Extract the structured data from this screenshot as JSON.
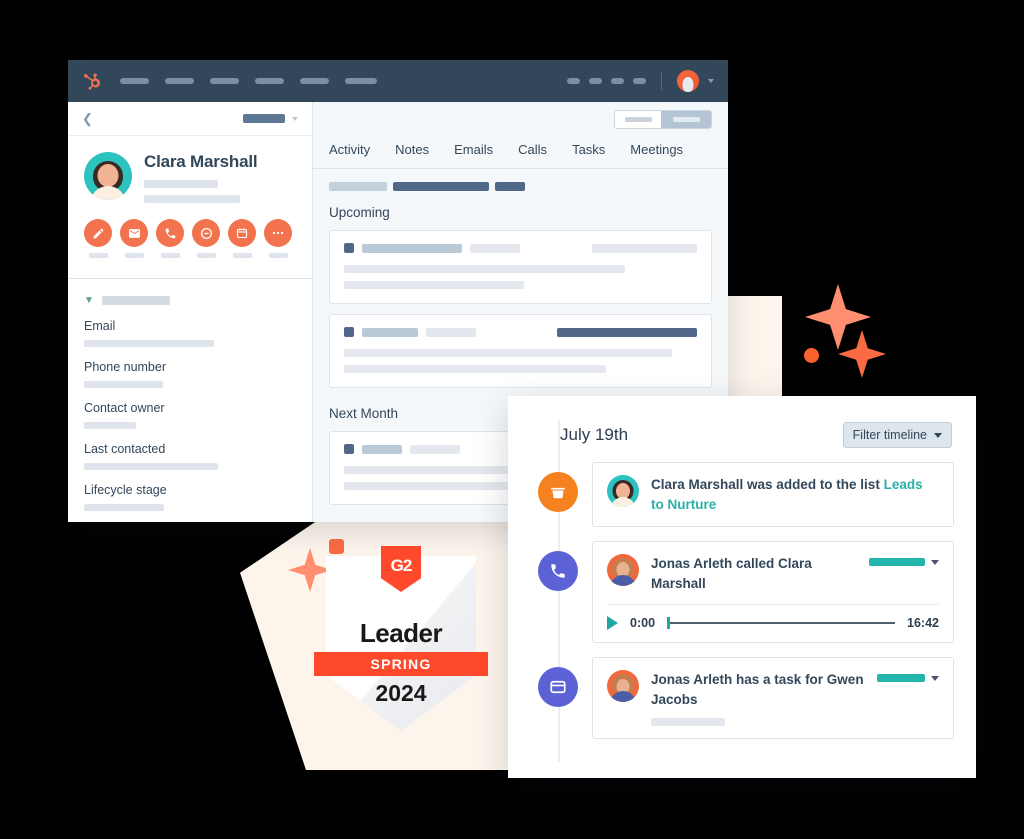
{
  "crm": {
    "navbar": {
      "logo_icon": "hubspot-sprocket-logo",
      "avatar_icon": "user-avatar",
      "caret_icon": "chevron-down-icon"
    },
    "sidebar": {
      "back_icon": "chevron-left-icon",
      "contact_name": "Clara Marshall",
      "actions": [
        {
          "icon": "note-pencil-icon",
          "name": "note"
        },
        {
          "icon": "email-envelope-icon",
          "name": "email"
        },
        {
          "icon": "phone-call-icon",
          "name": "call"
        },
        {
          "icon": "log-activity-icon",
          "name": "log"
        },
        {
          "icon": "calendar-meeting-icon",
          "name": "meeting"
        },
        {
          "icon": "ellipsis-more-icon",
          "name": "more"
        }
      ],
      "section_chevron_icon": "chevron-down-icon",
      "properties": [
        {
          "label": "Email",
          "value_width": 130
        },
        {
          "label": "Phone number",
          "value_width": 79
        },
        {
          "label": "Contact owner",
          "value_width": 52
        },
        {
          "label": "Last contacted",
          "value_width": 134
        },
        {
          "label": "Lifecycle stage",
          "value_width": 80
        }
      ]
    },
    "content": {
      "tabs": [
        "Activity",
        "Notes",
        "Emails",
        "Calls",
        "Tasks",
        "Meetings"
      ],
      "sections": [
        {
          "title": "Upcoming",
          "cards": [
            {
              "bars": [
                100,
                50,
                6,
                105
              ],
              "lines": [
                281,
                180
              ]
            },
            {
              "bars": [
                56,
                50,
                54,
                140
              ],
              "lines": [
                328,
                262
              ]
            }
          ]
        },
        {
          "title": "Next Month",
          "cards": [
            {
              "bars": [
                40,
                50,
                0,
                0
              ],
              "lines": [
                300,
                300
              ]
            }
          ]
        }
      ]
    }
  },
  "g2_badge": {
    "logo_text": "G2",
    "award": "Leader",
    "season": "SPRING",
    "year": "2024"
  },
  "timeline": {
    "date": "July 19th",
    "filter_label": "Filter timeline",
    "filter_caret_icon": "chevron-down-icon",
    "entries": [
      {
        "icon": "list-folder-icon",
        "icon_color": "#f5811f",
        "avatar": "clara",
        "text_before": "Clara Marshall was added to the list ",
        "link_text": "Leads to Nurture",
        "has_badge": false,
        "has_player": false
      },
      {
        "icon": "phone-call-icon",
        "icon_color": "#5c62d6",
        "avatar": "jonas",
        "text_before": "Jonas Arleth called Clara Marshall",
        "link_text": "",
        "has_badge": true,
        "badge_width": 56,
        "has_player": true,
        "player": {
          "play_icon": "play-triangle-icon",
          "current_time": "0:00",
          "total_time": "16:42"
        }
      },
      {
        "icon": "task-window-icon",
        "icon_color": "#5c62d6",
        "avatar": "jonas",
        "text_before": "Jonas Arleth has a task for Gwen Jacobs",
        "link_text": "",
        "has_badge": true,
        "badge_width": 48,
        "has_player": false,
        "has_ghost_line": true
      }
    ]
  },
  "decor": {
    "sparkle_color": "#ff8f70",
    "dot_color": "#f8622e",
    "blob_color": "#fdf5ec"
  }
}
